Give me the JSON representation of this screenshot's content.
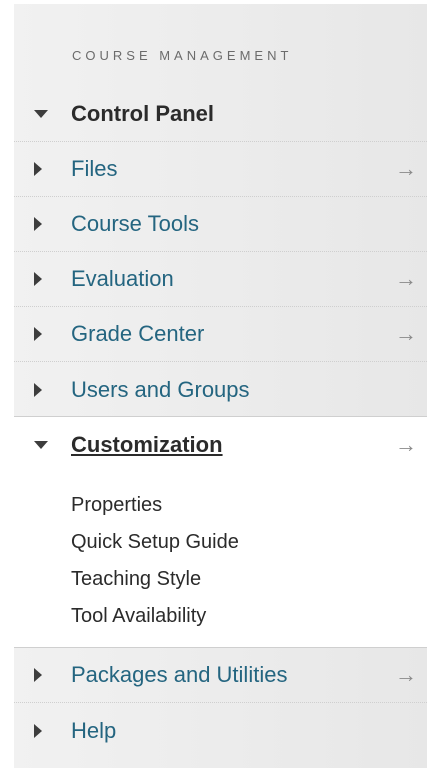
{
  "section_heading": "COURSE MANAGEMENT",
  "menu": [
    {
      "label": "Control Panel",
      "expanded": true,
      "arrow": ""
    },
    {
      "label": "Files",
      "expanded": false,
      "arrow": "→"
    },
    {
      "label": "Course Tools",
      "expanded": false,
      "arrow": ""
    },
    {
      "label": "Evaluation",
      "expanded": false,
      "arrow": "→"
    },
    {
      "label": "Grade Center",
      "expanded": false,
      "arrow": "→"
    },
    {
      "label": "Users and Groups",
      "expanded": false,
      "arrow": ""
    },
    {
      "label": "Customization",
      "expanded": true,
      "arrow": "→"
    },
    {
      "label": "Packages and Utilities",
      "expanded": false,
      "arrow": "→"
    },
    {
      "label": "Help",
      "expanded": false,
      "arrow": ""
    }
  ],
  "customization_items": [
    "Properties",
    "Quick Setup Guide",
    "Teaching Style",
    "Tool Availability"
  ],
  "icons": {
    "collapsed": "triangle-right-icon",
    "expanded": "triangle-down-icon",
    "go": "arrow-right-icon"
  },
  "colors": {
    "link": "#246580",
    "text": "#2b2b2b",
    "panel_bg": "#ececec",
    "active_bg": "#ffffff"
  }
}
